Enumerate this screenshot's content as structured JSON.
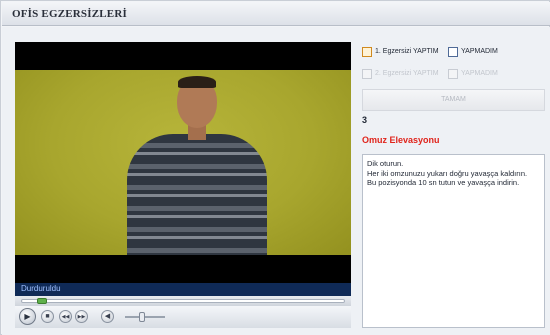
{
  "window": {
    "title": "OFİS EGZERSİZLERİ"
  },
  "player": {
    "status": "Durduruldu",
    "seek_progress": 0.05,
    "volume": 0.4,
    "controls": {
      "play": "▶",
      "stop": "■",
      "previous": "◀◀",
      "next": "▶▶",
      "mute": "◀"
    }
  },
  "exercise1": {
    "done_label": "1. Egzersizi YAPTIM",
    "not_done_label": "YAPMADIM"
  },
  "exercise2": {
    "done_label": "2. Egzersizi YAPTIM",
    "not_done_label": "YAPMADIM"
  },
  "ok_button": {
    "label": "TAMAM"
  },
  "counter": "3",
  "exercise_title": "Omuz Elevasyonu",
  "instructions": "Dik oturun.\nHer iki omzunuzu yukarı doğru yavaşça kaldırın.\nBu pozisyonda 10 sn tutun ve yavaşça indirin.",
  "colors": {
    "title_red": "#e0241b",
    "status_bar": "#0f2a57",
    "accent_orange": "#d08a1f",
    "accent_blue": "#4f6a97"
  }
}
